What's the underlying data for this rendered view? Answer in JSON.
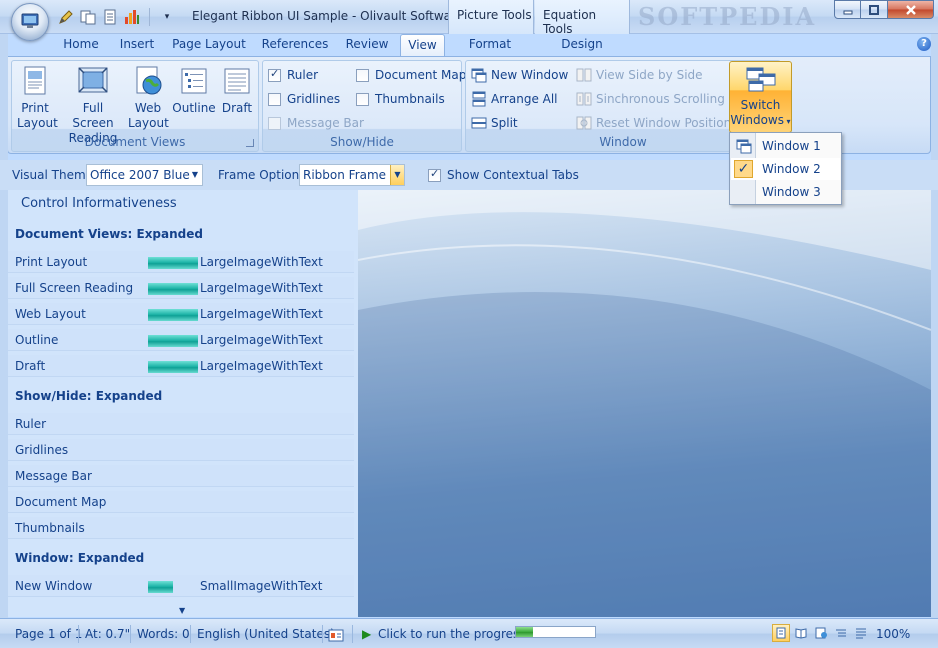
{
  "window": {
    "title": "Elegant Ribbon UI Sample - Olivault Software",
    "contextual_headers": [
      "Picture Tools",
      "Equation Tools"
    ],
    "watermark": "SOFTPEDIA"
  },
  "tabs": [
    "Home",
    "Insert",
    "Page Layout",
    "References",
    "Review",
    "View",
    "Format",
    "Design"
  ],
  "active_tab": "View",
  "ribbon": {
    "document_views": {
      "title": "Document Views",
      "buttons": [
        {
          "line1": "Print",
          "line2": "Layout"
        },
        {
          "line1": "Full Screen",
          "line2": "Reading"
        },
        {
          "line1": "Web",
          "line2": "Layout"
        },
        {
          "line1": "Outline",
          "line2": ""
        },
        {
          "line1": "Draft",
          "line2": ""
        }
      ]
    },
    "show_hide": {
      "title": "Show/Hide",
      "ruler": "Ruler",
      "gridlines": "Gridlines",
      "message_bar": "Message Bar",
      "document_map": "Document Map",
      "thumbnails": "Thumbnails"
    },
    "window": {
      "title": "Window",
      "new_window": "New Window",
      "arrange_all": "Arrange All",
      "split": "Split",
      "view_side_by_side": "View Side by Side",
      "sync_scrolling": "Sinchronous Scrolling",
      "reset_position": "Reset Window Position",
      "switch_line1": "Switch",
      "switch_line2": "Windows"
    }
  },
  "switch_menu": [
    "Window 1",
    "Window 2",
    "Window 3"
  ],
  "switch_menu_checked": "Window 2",
  "options": {
    "visual_theme_label": "Visual Theme",
    "visual_theme_value": "Office 2007 Blue",
    "frame_options_label": "Frame Options",
    "frame_options_value": "Ribbon Frame",
    "contextual_tabs_label": "Show Contextual Tabs"
  },
  "panel": {
    "title": "Control Informativeness",
    "sections": {
      "doc_views": "Document Views: Expanded",
      "show_hide": "Show/Hide: Expanded",
      "window": "Window: Expanded"
    },
    "doc_views_rows": [
      {
        "name": "Print Layout",
        "value": "LargeImageWithText"
      },
      {
        "name": "Full Screen Reading",
        "value": "LargeImageWithText"
      },
      {
        "name": "Web Layout",
        "value": "LargeImageWithText"
      },
      {
        "name": "Outline",
        "value": "LargeImageWithText"
      },
      {
        "name": "Draft",
        "value": "LargeImageWithText"
      }
    ],
    "show_hide_rows": [
      {
        "name": "Ruler"
      },
      {
        "name": "Gridlines"
      },
      {
        "name": "Message Bar"
      },
      {
        "name": "Document Map"
      },
      {
        "name": "Thumbnails"
      }
    ],
    "window_rows": [
      {
        "name": "New Window",
        "value": "SmallImageWithText"
      }
    ]
  },
  "status": {
    "page": "Page 1 of 1",
    "at": "At: 0.7\"",
    "words": "Words: 0",
    "language": "English (United States)",
    "run_progress": "Click to run the progress",
    "progress_fraction": 0.22,
    "zoom": "100%"
  },
  "colors": {
    "accent": "#15428b",
    "progress": "#3aa83a",
    "highlight": "#ffcf5c",
    "bar": "#1fb5a8"
  }
}
